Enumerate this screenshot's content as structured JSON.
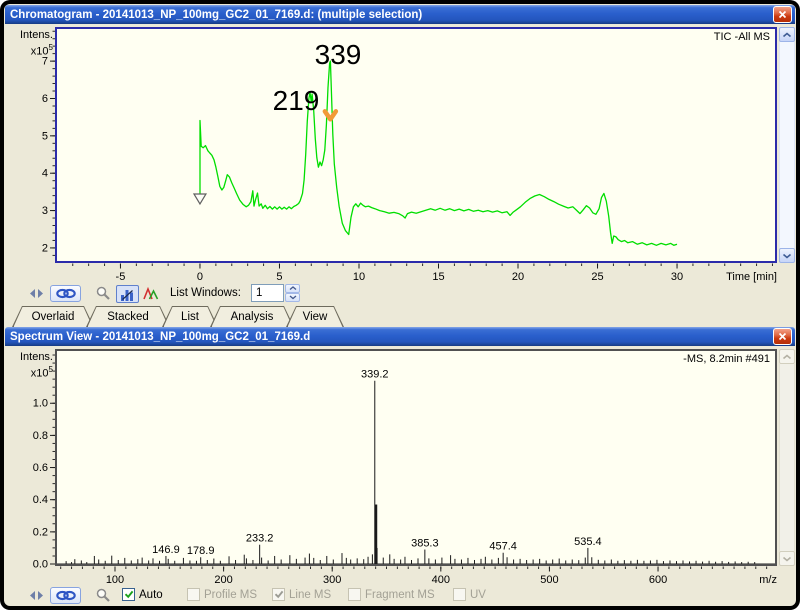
{
  "chromatogram_window": {
    "title": "Chromatogram - 20141013_NP_100mg_GC2_01_7169.d: (multiple selection)",
    "trace_label": "TIC -All MS",
    "y_caption": {
      "line1": "Intens.",
      "base": "x10",
      "exp": "5"
    }
  },
  "chromatogram_toolbar": {
    "icons": [
      "compress-arrows-icon",
      "link-icon",
      "zoom-icon",
      "profile-chart-icon",
      "peaks-icon"
    ],
    "list_windows_label": "List Windows:",
    "list_windows_value": "1"
  },
  "tabs": [
    {
      "label": "Overlaid"
    },
    {
      "label": "Stacked"
    },
    {
      "label": "List"
    },
    {
      "label": "Analysis"
    },
    {
      "label": "View"
    }
  ],
  "spectrum_window": {
    "title": "Spectrum View - 20141013_NP_100mg_GC2_01_7169.d",
    "scan_label": "-MS, 8.2min #491",
    "y_caption": {
      "line1": "Intens.",
      "base": "x10",
      "exp": "5"
    }
  },
  "spectrum_toolbar": {
    "icons": [
      "compress-arrows-icon",
      "link-icon",
      "zoom-icon"
    ],
    "checkboxes": [
      {
        "label": "Auto",
        "checked": true,
        "enabled": true
      },
      {
        "label": "Profile MS",
        "checked": false,
        "enabled": false
      },
      {
        "label": "Line MS",
        "checked": true,
        "enabled": false
      },
      {
        "label": "Fragment MS",
        "checked": false,
        "enabled": false
      },
      {
        "label": "UV",
        "checked": false,
        "enabled": false
      }
    ]
  },
  "colors": {
    "trace_green": "#00DE00",
    "peak_stick": "#1A1A1A",
    "annotation_arrow_orange": "#F29A38",
    "titlebar_blue": "#2A5FCC",
    "desktop_beige": "#ECE9D8",
    "plot_ivory": "#FFFFF2",
    "check_green": "#1BA11B"
  },
  "chart_data": [
    {
      "type": "line",
      "title": "TIC -All MS",
      "xlabel": "Time [min]",
      "ylabel": "Intens. x10^5",
      "x_ticks": [
        -5,
        0,
        5,
        10,
        15,
        20,
        25,
        30
      ],
      "y_ticks": [
        2,
        3,
        4,
        5,
        6,
        7
      ],
      "x_minor_step": 1,
      "y_minor_step": 0.2,
      "y_tick_decimals": 0,
      "xlim": [
        -8.99,
        36.16
      ],
      "ylim": [
        1.65,
        7.86
      ],
      "grid": false,
      "annotations": [
        {
          "text": "219",
          "t": 6.04,
          "v": 6.23
        },
        {
          "text": "339",
          "t": 8.68,
          "v": 7.46
        }
      ],
      "marker": {
        "name": "start-triangle-marker",
        "t": 0,
        "v": 3.31
      },
      "arrow": {
        "name": "orange-peak-arrow",
        "t": 8.2,
        "v": 5.55
      },
      "points": [
        [
          0,
          3.33
        ],
        [
          0,
          5.41
        ],
        [
          0.08,
          4.72
        ],
        [
          0.2,
          4.68
        ],
        [
          0.35,
          4.74
        ],
        [
          0.5,
          4.6
        ],
        [
          0.62,
          4.54
        ],
        [
          0.75,
          4.48
        ],
        [
          0.88,
          4.36
        ],
        [
          1,
          4.16
        ],
        [
          1.12,
          3.92
        ],
        [
          1.25,
          3.65
        ],
        [
          1.38,
          3.55
        ],
        [
          1.5,
          3.62
        ],
        [
          1.62,
          3.8
        ],
        [
          1.72,
          3.96
        ],
        [
          1.85,
          3.9
        ],
        [
          2,
          3.74
        ],
        [
          2.15,
          3.6
        ],
        [
          2.3,
          3.46
        ],
        [
          2.5,
          3.28
        ],
        [
          2.7,
          3.17
        ],
        [
          2.9,
          3.1
        ],
        [
          3.05,
          3.14
        ],
        [
          3.2,
          3.24
        ],
        [
          3.32,
          3.53
        ],
        [
          3.4,
          3.12
        ],
        [
          3.5,
          3.3
        ],
        [
          3.62,
          3.47
        ],
        [
          3.72,
          3.12
        ],
        [
          3.85,
          3.18
        ],
        [
          3.95,
          3.06
        ],
        [
          4.1,
          3.14
        ],
        [
          4.25,
          3.05
        ],
        [
          4.4,
          3.11
        ],
        [
          4.55,
          3.04
        ],
        [
          4.7,
          3.1
        ],
        [
          4.85,
          3.04
        ],
        [
          5,
          3.1
        ],
        [
          5.15,
          3.04
        ],
        [
          5.3,
          3.09
        ],
        [
          5.45,
          3.04
        ],
        [
          5.6,
          3.1
        ],
        [
          5.75,
          3.05
        ],
        [
          5.9,
          3.11
        ],
        [
          6.05,
          3.14
        ],
        [
          6.2,
          3.19
        ],
        [
          6.3,
          3.26
        ],
        [
          6.45,
          3.46
        ],
        [
          6.55,
          3.82
        ],
        [
          6.65,
          4.5
        ],
        [
          6.75,
          5.4
        ],
        [
          6.85,
          6
        ],
        [
          6.92,
          6.16
        ],
        [
          7,
          5.9
        ],
        [
          7.05,
          6.12
        ],
        [
          7.15,
          5.68
        ],
        [
          7.25,
          4.92
        ],
        [
          7.35,
          4.42
        ],
        [
          7.45,
          4.16
        ],
        [
          7.55,
          4.3
        ],
        [
          7.65,
          4.2
        ],
        [
          7.75,
          4.36
        ],
        [
          7.85,
          4.62
        ],
        [
          7.95,
          5.3
        ],
        [
          8.05,
          6.3
        ],
        [
          8.15,
          6.94
        ],
        [
          8.2,
          7
        ],
        [
          8.26,
          6.28
        ],
        [
          8.35,
          5.05
        ],
        [
          8.45,
          4.25
        ],
        [
          8.6,
          3.62
        ],
        [
          8.75,
          3.12
        ],
        [
          8.95,
          2.66
        ],
        [
          9.15,
          2.46
        ],
        [
          9.35,
          2.36
        ],
        [
          9.5,
          2.82
        ],
        [
          9.65,
          3.1
        ],
        [
          9.8,
          3.18
        ],
        [
          9.95,
          3.1
        ],
        [
          10.1,
          3.2
        ],
        [
          10.25,
          3.14
        ],
        [
          10.4,
          3.1
        ],
        [
          10.6,
          3.12
        ],
        [
          10.8,
          3.08
        ],
        [
          11,
          3.05
        ],
        [
          11.3,
          3
        ],
        [
          11.6,
          2.97
        ],
        [
          11.9,
          2.93
        ],
        [
          12.2,
          2.95
        ],
        [
          12.5,
          2.92
        ],
        [
          12.75,
          2.86
        ],
        [
          12.9,
          2.8
        ],
        [
          13.05,
          2.92
        ],
        [
          13.3,
          2.96
        ],
        [
          13.6,
          2.93
        ],
        [
          13.9,
          2.97
        ],
        [
          14.2,
          3.01
        ],
        [
          14.5,
          3.05
        ],
        [
          14.8,
          3.01
        ],
        [
          15.1,
          3.06
        ],
        [
          15.4,
          3.01
        ],
        [
          15.7,
          3.05
        ],
        [
          16,
          3
        ],
        [
          16.3,
          3.04
        ],
        [
          16.6,
          2.99
        ],
        [
          16.9,
          3.03
        ],
        [
          17.2,
          2.98
        ],
        [
          17.5,
          3.01
        ],
        [
          17.8,
          2.97
        ],
        [
          18.1,
          3
        ],
        [
          18.4,
          2.96
        ],
        [
          18.7,
          2.99
        ],
        [
          19,
          2.94
        ],
        [
          19.3,
          2.97
        ],
        [
          19.5,
          2.87
        ],
        [
          19.7,
          2.96
        ],
        [
          19.9,
          3.02
        ],
        [
          20.15,
          3.1
        ],
        [
          20.45,
          3.22
        ],
        [
          20.75,
          3.32
        ],
        [
          21.05,
          3.39
        ],
        [
          21.35,
          3.43
        ],
        [
          21.65,
          3.37
        ],
        [
          21.95,
          3.3
        ],
        [
          22.25,
          3.24
        ],
        [
          22.55,
          3.17
        ],
        [
          22.85,
          3.12
        ],
        [
          23.15,
          3.07
        ],
        [
          23.45,
          3.1
        ],
        [
          23.7,
          3
        ],
        [
          23.9,
          2.92
        ],
        [
          24.1,
          3.02
        ],
        [
          24.3,
          3.13
        ],
        [
          24.5,
          3.07
        ],
        [
          24.7,
          2.94
        ],
        [
          24.9,
          2.9
        ],
        [
          25.1,
          3.05
        ],
        [
          25.25,
          3.35
        ],
        [
          25.4,
          3.46
        ],
        [
          25.55,
          3.25
        ],
        [
          25.7,
          2.85
        ],
        [
          25.82,
          2.4
        ],
        [
          25.92,
          2.12
        ],
        [
          26.02,
          2.32
        ],
        [
          26.15,
          2.3
        ],
        [
          26.3,
          2.22
        ],
        [
          26.5,
          2.17
        ],
        [
          26.7,
          2.2
        ],
        [
          26.9,
          2.14
        ],
        [
          27.2,
          2.17
        ],
        [
          27.5,
          2.1
        ],
        [
          27.8,
          2.14
        ],
        [
          28.1,
          2.08
        ],
        [
          28.4,
          2.12
        ],
        [
          28.7,
          2.07
        ],
        [
          29,
          2.12
        ],
        [
          29.3,
          2.08
        ],
        [
          29.6,
          2.12
        ],
        [
          29.8,
          2.07
        ],
        [
          30,
          2.1
        ]
      ]
    },
    {
      "type": "stick",
      "title": "-MS, 8.2min #491",
      "xlabel": "m/z",
      "ylabel": "Intens. x10^5",
      "x_ticks": [
        100,
        200,
        300,
        400,
        500,
        600
      ],
      "y_ticks": [
        0,
        0.2,
        0.4,
        0.6,
        0.8,
        1.0
      ],
      "x_minor_step": 10,
      "y_minor_step": 0.05,
      "y_tick_decimals": 1,
      "xlim": [
        46.6,
        707.7
      ],
      "ylim": [
        0,
        1.325
      ],
      "grid": false,
      "peaks": [
        [
          55,
          0.018
        ],
        [
          60,
          0.012
        ],
        [
          63,
          0.03
        ],
        [
          69,
          0.022
        ],
        [
          74,
          0.012
        ],
        [
          81,
          0.05
        ],
        [
          85,
          0.028
        ],
        [
          91,
          0.02
        ],
        [
          97,
          0.052
        ],
        [
          103,
          0.025
        ],
        [
          109,
          0.038
        ],
        [
          115,
          0.022
        ],
        [
          121,
          0.03
        ],
        [
          125,
          0.04
        ],
        [
          131,
          0.022
        ],
        [
          135,
          0.035
        ],
        [
          141,
          0.02
        ],
        [
          146.9,
          0.05,
          "146.9"
        ],
        [
          149,
          0.032
        ],
        [
          155,
          0.02
        ],
        [
          163,
          0.038
        ],
        [
          169,
          0.022
        ],
        [
          175,
          0.02
        ],
        [
          178.9,
          0.042,
          "178.9"
        ],
        [
          185,
          0.025
        ],
        [
          191,
          0.034
        ],
        [
          197,
          0.02
        ],
        [
          205,
          0.048
        ],
        [
          211,
          0.025
        ],
        [
          219,
          0.058
        ],
        [
          221,
          0.035
        ],
        [
          227,
          0.025
        ],
        [
          233.2,
          0.12,
          "233.2"
        ],
        [
          235,
          0.04
        ],
        [
          241,
          0.022
        ],
        [
          247,
          0.05
        ],
        [
          253,
          0.028
        ],
        [
          261,
          0.055
        ],
        [
          267,
          0.032
        ],
        [
          275,
          0.04
        ],
        [
          279,
          0.065
        ],
        [
          283,
          0.038
        ],
        [
          289,
          0.025
        ],
        [
          295,
          0.05
        ],
        [
          301,
          0.028
        ],
        [
          309,
          0.068
        ],
        [
          313,
          0.038
        ],
        [
          317,
          0.028
        ],
        [
          323,
          0.035
        ],
        [
          329,
          0.03
        ],
        [
          333,
          0.045
        ],
        [
          337,
          0.06
        ],
        [
          339.2,
          1.14,
          "339.2"
        ],
        [
          340.3,
          0.37,
          null,
          2.5
        ],
        [
          341.3,
          0.1
        ],
        [
          347,
          0.04
        ],
        [
          353,
          0.06
        ],
        [
          357,
          0.032
        ],
        [
          363,
          0.028
        ],
        [
          367,
          0.045
        ],
        [
          373,
          0.025
        ],
        [
          379,
          0.035
        ],
        [
          385.3,
          0.09,
          "385.3"
        ],
        [
          389,
          0.035
        ],
        [
          395,
          0.028
        ],
        [
          401,
          0.04
        ],
        [
          409,
          0.055
        ],
        [
          413,
          0.032
        ],
        [
          419,
          0.028
        ],
        [
          425,
          0.038
        ],
        [
          431,
          0.025
        ],
        [
          437,
          0.032
        ],
        [
          441,
          0.045
        ],
        [
          447,
          0.028
        ],
        [
          453,
          0.038
        ],
        [
          457.4,
          0.07,
          "457.4"
        ],
        [
          461,
          0.042
        ],
        [
          467,
          0.028
        ],
        [
          473,
          0.032
        ],
        [
          479,
          0.025
        ],
        [
          485,
          0.028
        ],
        [
          491,
          0.032
        ],
        [
          497,
          0.022
        ],
        [
          503,
          0.028
        ],
        [
          509,
          0.034
        ],
        [
          515,
          0.022
        ],
        [
          521,
          0.028
        ],
        [
          527,
          0.024
        ],
        [
          533,
          0.04
        ],
        [
          535.4,
          0.1,
          "535.4"
        ],
        [
          539,
          0.042
        ],
        [
          545,
          0.026
        ],
        [
          551,
          0.022
        ],
        [
          557,
          0.028
        ],
        [
          563,
          0.02
        ],
        [
          569,
          0.024
        ],
        [
          575,
          0.02
        ],
        [
          581,
          0.026
        ],
        [
          587,
          0.02
        ],
        [
          593,
          0.022
        ],
        [
          599,
          0.026
        ],
        [
          605,
          0.018
        ],
        [
          611,
          0.022
        ],
        [
          617,
          0.018
        ],
        [
          623,
          0.022
        ],
        [
          629,
          0.016
        ],
        [
          635,
          0.02
        ],
        [
          641,
          0.015
        ],
        [
          647,
          0.02
        ],
        [
          653,
          0.014
        ],
        [
          659,
          0.018
        ],
        [
          665,
          0.013
        ],
        [
          671,
          0.016
        ],
        [
          677,
          0.012
        ],
        [
          683,
          0.014
        ],
        [
          689,
          0.012
        ]
      ]
    }
  ]
}
